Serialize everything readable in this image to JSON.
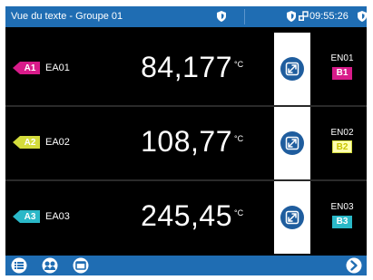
{
  "titlebar": {
    "title": "Vue du texte - Groupe 01",
    "time": "09:55:26",
    "icons": [
      "shield-icon",
      "shield-icon",
      "usb-icon",
      "shield-icon"
    ]
  },
  "channels": [
    {
      "tag": "A1",
      "name": "EA01",
      "value": "84,177",
      "unit": "°C",
      "output_label": "EN01",
      "output_badge": "B1",
      "tag_color": "#d81b8a",
      "badge_bg": "#d81b8a",
      "badge_fg": "#ffffff"
    },
    {
      "tag": "A2",
      "name": "EA02",
      "value": "108,77",
      "unit": "°C",
      "output_label": "EN02",
      "output_badge": "B2",
      "tag_color": "#d4dc3c",
      "badge_bg": "#ffffb0",
      "badge_fg": "#c9c400"
    },
    {
      "tag": "A3",
      "name": "EA03",
      "value": "245,45",
      "unit": "°C",
      "output_label": "EN03",
      "output_badge": "B3",
      "tag_color": "#2ab8c8",
      "badge_bg": "#2ab8c8",
      "badge_fg": "#ffffff"
    }
  ],
  "toolbar": {
    "icons": [
      "menu-list-icon",
      "channels-icon",
      "window-icon",
      "next-arrow-icon"
    ]
  },
  "colors": {
    "accent": "#1f6db3",
    "background": "#000000"
  }
}
